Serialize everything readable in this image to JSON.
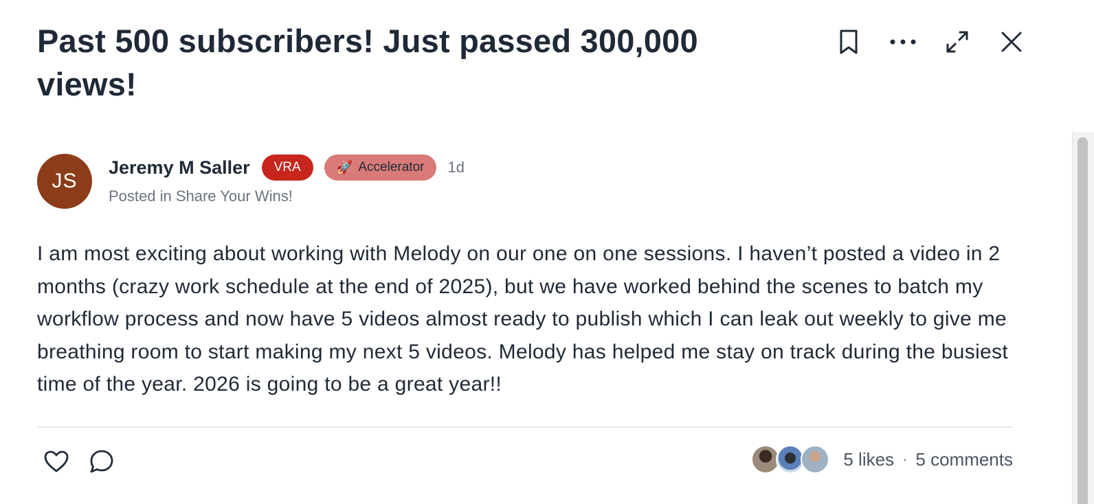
{
  "post": {
    "title": "Past 500 subscribers! Just passed 300,000 views!",
    "author": {
      "initials": "JS",
      "name": "Jeremy M Saller",
      "avatar_color": "#8b3d19"
    },
    "badges": {
      "vra": "VRA",
      "accelerator_emoji": "🚀",
      "accelerator_label": "Accelerator"
    },
    "time_ago": "1d",
    "posted_in": "Posted in Share Your Wins!",
    "body": "I am most exciting about working with Melody on our one on one sessions.  I haven’t posted a video in 2 months (crazy work schedule at the end of 2025), but we have worked behind the scenes to batch my workflow process and now have 5 videos almost ready to publish which I can leak out weekly to give me breathing room to start making my next 5 videos.  Melody has helped me stay on track during the busiest time of the year.  2026 is going to be a great year!!"
  },
  "header_actions": {
    "icons": [
      "bookmark-icon",
      "more-icon",
      "expand-icon",
      "close-icon"
    ]
  },
  "footer": {
    "likes_label": "5 likes",
    "separator": "·",
    "comments_label": "5 comments",
    "icons": [
      "heart-icon",
      "comment-icon"
    ]
  },
  "colors": {
    "vra_badge": "#c8261d",
    "accelerator_badge": "#d97a78",
    "text_primary": "#1f2937",
    "text_secondary": "#6b7280"
  }
}
